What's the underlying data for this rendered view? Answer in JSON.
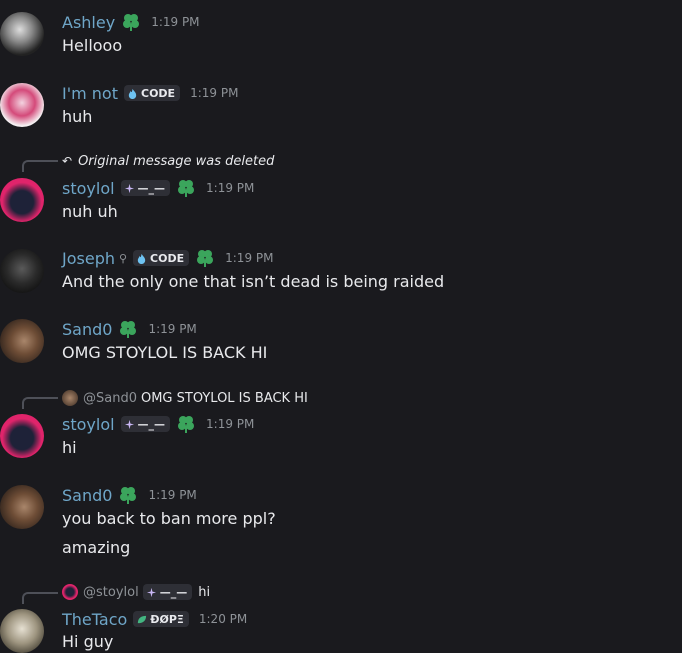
{
  "messages": [
    {
      "user": "Ashley",
      "time": "1:19 PM",
      "text": "Hellooo"
    },
    {
      "user": "I'm not",
      "tag": "CODE",
      "time": "1:19 PM",
      "text": "huh"
    },
    {
      "reply_text": "Original message was deleted",
      "user": "stoylol",
      "tag": "—_—",
      "time": "1:19 PM",
      "text": "nuh uh"
    },
    {
      "user": "Joseph",
      "tag": "CODE",
      "time": "1:19 PM",
      "text": "And the only one that isn’t dead is being raided"
    },
    {
      "user": "Sand0",
      "time": "1:19 PM",
      "text": "OMG STOYLOL IS BACK HI"
    },
    {
      "reply_name": "@Sand0",
      "reply_text": "OMG STOYLOL IS BACK HI",
      "user": "stoylol",
      "tag": "—_—",
      "time": "1:19 PM",
      "text": "hi"
    },
    {
      "user": "Sand0",
      "time": "1:19 PM",
      "text": "you back to ban more ppl?",
      "text2": "amazing"
    },
    {
      "reply_name": "@stoylol",
      "reply_tag": "—_—",
      "reply_text": "hi",
      "user": "TheTaco",
      "tag": "ÐØPΞ",
      "time": "1:20 PM",
      "text": "Hi guy"
    }
  ],
  "colors": {
    "background": "#1a1a1e",
    "username": "#6fa6c8",
    "badge": "#3ba55c"
  }
}
